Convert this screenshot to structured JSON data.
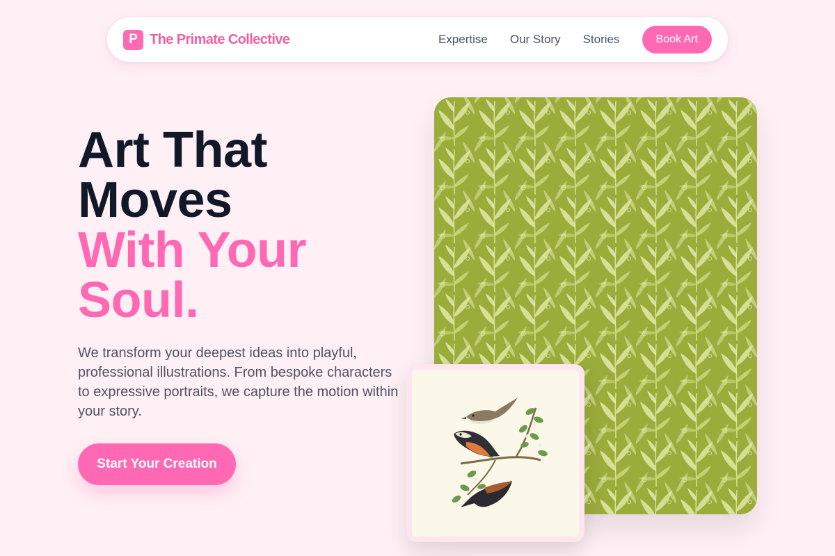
{
  "brand": {
    "mark": "P",
    "name": "The Primate Collective"
  },
  "nav": {
    "links": [
      "Expertise",
      "Our Story",
      "Stories"
    ],
    "cta": "Book Art"
  },
  "hero": {
    "headline_dark": [
      "Art That",
      "Moves"
    ],
    "headline_pink": [
      "With Your",
      "Soul."
    ],
    "lede": "We transform your deepest ideas into playful, professional illustrations. From bespoke characters to expressive portraits, we capture the motion within your story.",
    "cta": "Start Your Creation"
  },
  "colors": {
    "accent": "#ff69b4",
    "brand_text": "#f0609f",
    "heading": "#111827",
    "body": "#4b5563",
    "background": "#fff0f5",
    "pattern_base": "#9cae3c",
    "pattern_leaf": "#eaf0b4"
  },
  "images": {
    "main": "green-leaf-pattern-artwork",
    "card": "birds-on-branch-illustration"
  }
}
